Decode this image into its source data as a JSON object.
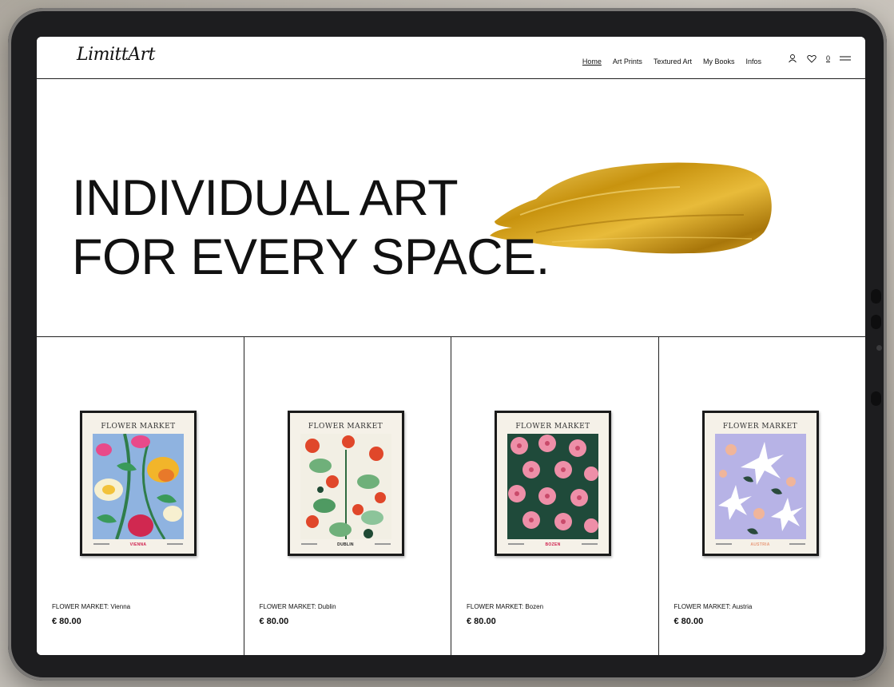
{
  "logo": "LimittArt",
  "nav": {
    "items": [
      {
        "label": "Home",
        "active": true
      },
      {
        "label": "Art Prints",
        "active": false
      },
      {
        "label": "Textured Art",
        "active": false
      },
      {
        "label": "My Books",
        "active": false
      },
      {
        "label": "Infos",
        "active": false
      }
    ],
    "cart_count": "0",
    "icons": [
      "user-icon",
      "heart-icon",
      "cart-icon",
      "menu-icon"
    ]
  },
  "hero": {
    "line1": "INDIVIDUAL ART",
    "line2": "FOR EVERY SPACE.",
    "accent_color": "#d4a017"
  },
  "products": [
    {
      "name": "FLOWER MARKET: Vienna",
      "price": "€ 80.00",
      "poster_title": "FLOWER MARKET",
      "poster_city": "VIENNA",
      "city_color": "#d0204e"
    },
    {
      "name": "FLOWER MARKET: Dublin",
      "price": "€ 80.00",
      "poster_title": "FLOWER MARKET",
      "poster_city": "DUBLIN",
      "city_color": "#222222"
    },
    {
      "name": "FLOWER MARKET: Bozen",
      "price": "€ 80.00",
      "poster_title": "FLOWER MARKET",
      "poster_city": "BOZEN",
      "city_color": "#d0204e"
    },
    {
      "name": "FLOWER MARKET: Austria",
      "price": "€ 80.00",
      "poster_title": "FLOWER MARKET",
      "poster_city": "AUSTRIA",
      "city_color": "#e89a7a"
    }
  ]
}
